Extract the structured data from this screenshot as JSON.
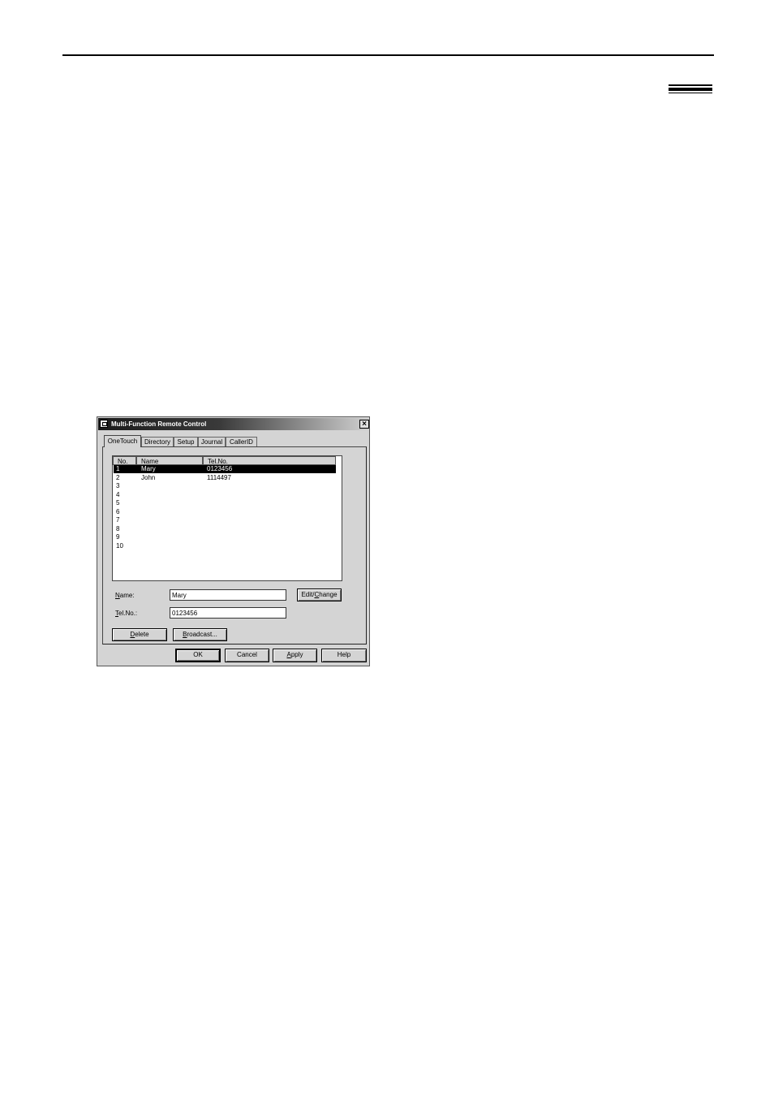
{
  "dialog": {
    "title": "Multi-Function Remote Control",
    "close_label": "×",
    "tabs": [
      {
        "label": "OneTouch",
        "active": true
      },
      {
        "label": "Directory",
        "active": false
      },
      {
        "label": "Setup",
        "active": false
      },
      {
        "label": "Journal",
        "active": false
      },
      {
        "label": "CallerID",
        "active": false
      }
    ],
    "list": {
      "columns": [
        "No.",
        "Name",
        "Tel.No."
      ],
      "rows": [
        {
          "no": "1",
          "name": "Mary",
          "tel": "0123456",
          "selected": true
        },
        {
          "no": "2",
          "name": "John",
          "tel": "1114497",
          "selected": false
        },
        {
          "no": "3",
          "name": "",
          "tel": "",
          "selected": false
        },
        {
          "no": "4",
          "name": "",
          "tel": "",
          "selected": false
        },
        {
          "no": "5",
          "name": "",
          "tel": "",
          "selected": false
        },
        {
          "no": "6",
          "name": "",
          "tel": "",
          "selected": false
        },
        {
          "no": "7",
          "name": "",
          "tel": "",
          "selected": false
        },
        {
          "no": "8",
          "name": "",
          "tel": "",
          "selected": false
        },
        {
          "no": "9",
          "name": "",
          "tel": "",
          "selected": false
        },
        {
          "no": "10",
          "name": "",
          "tel": "",
          "selected": false
        }
      ]
    },
    "name_field": {
      "label_first": "N",
      "label_rest": "ame:",
      "value": "Mary"
    },
    "tel_field": {
      "label_first": "T",
      "label_rest": "el.No.:",
      "value": "0123456"
    },
    "buttons": {
      "edit_change": {
        "pre": "Edit/",
        "u": "C",
        "post": "hange"
      },
      "delete": {
        "u": "D",
        "post": "elete"
      },
      "broadcast": {
        "u": "B",
        "post": "roadcast..."
      },
      "ok": "OK",
      "cancel": "Cancel",
      "apply": {
        "u": "A",
        "post": "pply"
      },
      "help": "Help"
    }
  }
}
